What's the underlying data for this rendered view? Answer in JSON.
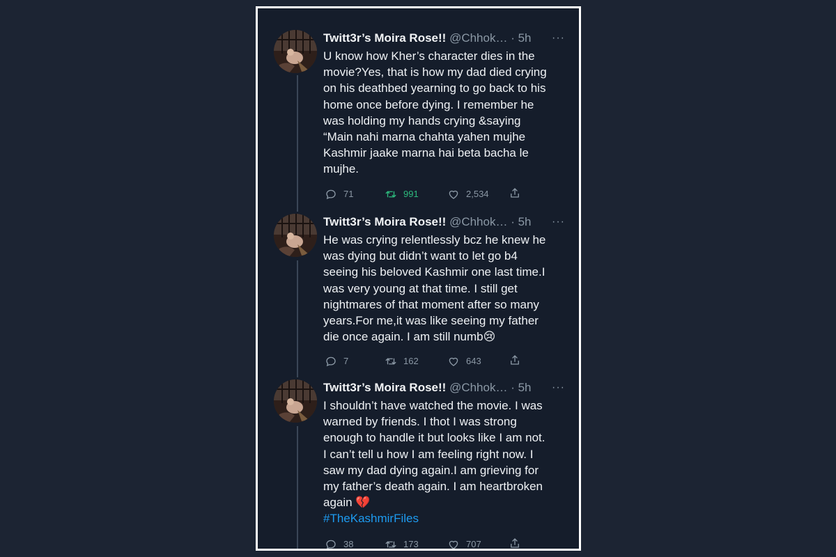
{
  "colors": {
    "page_background": "#1c2433",
    "card_background": "#151d2b",
    "text": "#eef1f4",
    "secondary_text": "#8b98a5",
    "retweet_active": "#2dba7d",
    "hashtag": "#1d9bf0"
  },
  "icons": {
    "reply": "reply-icon",
    "retweet": "retweet-icon",
    "like": "heart-icon",
    "share": "share-icon",
    "more": "more-icon"
  },
  "tweets": [
    {
      "name": "Twitt3r’s Moira Rose!!",
      "handle": "@Chhok…",
      "time": "· 5h",
      "more": "···",
      "lines": [
        "U know how Kher’s character dies in the",
        "movie?Yes, that is how my dad died crying",
        "on his deathbed yearning to go back to his",
        "home once before dying. I remember he",
        "was holding my hands crying &saying",
        "“Main nahi marna chahta yahen mujhe",
        "Kashmir jaake marna hai beta bacha le",
        "mujhe."
      ],
      "replies": "71",
      "retweets": "991",
      "retweeted": true,
      "likes": "2,534"
    },
    {
      "name": "Twitt3r’s Moira Rose!!",
      "handle": "@Chhok…",
      "time": "· 5h",
      "more": "···",
      "lines": [
        "He was crying relentlessly bcz he knew he",
        "was dying but didn’t want to let go b4",
        "seeing his beloved Kashmir one last time.I",
        "was very young at that time. I still get",
        "nightmares of that moment after so many",
        "years.For me,it was like seeing my father",
        "die once again. I am still numb"
      ],
      "end_emoji": "😢",
      "replies": "7",
      "retweets": "162",
      "retweeted": false,
      "likes": "643"
    },
    {
      "name": "Twitt3r’s Moira Rose!!",
      "handle": "@Chhok…",
      "time": "· 5h",
      "more": "···",
      "lines": [
        "I shouldn’t have watched the movie. I was",
        "warned by friends. I thot I was strong",
        "enough to handle it but looks like I am not.",
        "I can’t tell u how I am feeling right now. I",
        "saw my dad dying  again.I am grieving for",
        "my father’s death again. I am heartbroken",
        "again "
      ],
      "end_emoji": "💔",
      "hashtag": "#TheKashmirFiles",
      "replies": "38",
      "retweets": "173",
      "retweeted": false,
      "likes": "707"
    }
  ]
}
